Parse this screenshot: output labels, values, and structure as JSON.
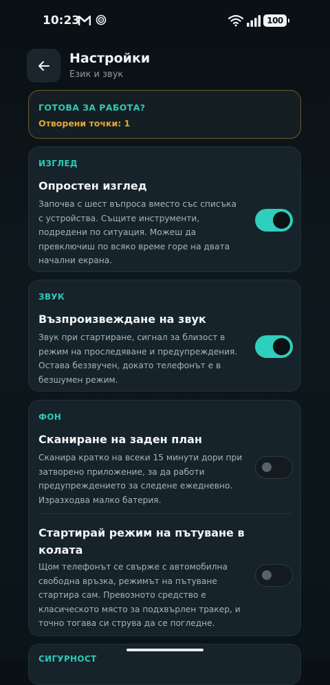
{
  "status_bar": {
    "time": "10:23",
    "battery": "100",
    "icons": [
      "gmail-m-icon",
      "circle-target-icon",
      "wifi-icon",
      "signal-icon",
      "battery-icon"
    ]
  },
  "header": {
    "title": "Настройки",
    "subtitle": "Език и звук",
    "back_icon": "arrow-left-icon"
  },
  "ready": {
    "title": "ГОТОВА ЗА РАБОТА?",
    "points": "Отворени точки: 1"
  },
  "appearance": {
    "label": "ИЗГЛЕД",
    "title": "Опростен изглед",
    "desc_lines": [
      "Започва с шест въпроса вместо със списъка",
      "с устройства. Същите инструменти,",
      "подредени по ситуация. Можеш да",
      "превключиш по всяко време горе на двата",
      "начални екрана."
    ],
    "enabled": true
  },
  "sound": {
    "label": "ЗВУК",
    "title": "Възпроизвеждане на звук",
    "desc_lines": [
      "Звук при стартиране, сигнал за близост в",
      "режим на проследяване и предупреждения.",
      "Остава беззвучен, докато телефонът е в",
      "безшумен режим."
    ],
    "enabled": true
  },
  "background": {
    "label": "ФОН",
    "scan": {
      "title": "Сканиране на заден план",
      "desc_lines": [
        "Сканира кратко на всеки 15 минути дори при",
        "затворено приложение, за да работи",
        "предупреждението за следене ежедневно.",
        "Изразходва малко батерия."
      ],
      "enabled": false
    },
    "car": {
      "title_lines": [
        "Стартирай режим на пътуване в",
        "колата"
      ],
      "desc_lines": [
        "Щом телефонът се свърже с автомобилна",
        "свободна връзка, режимът на пътуване",
        "стартира сам. Превозното средство е",
        "класическото място за подхвърлен тракер, и",
        "точно тогава си струва да се погледне."
      ],
      "enabled": false
    }
  },
  "next_section": {
    "label": "СИГУРНОСТ"
  },
  "colors": {
    "accent": "#2fcfbd",
    "warning": "#e2a73a",
    "card": "#17232a",
    "background": "#0b1418"
  }
}
